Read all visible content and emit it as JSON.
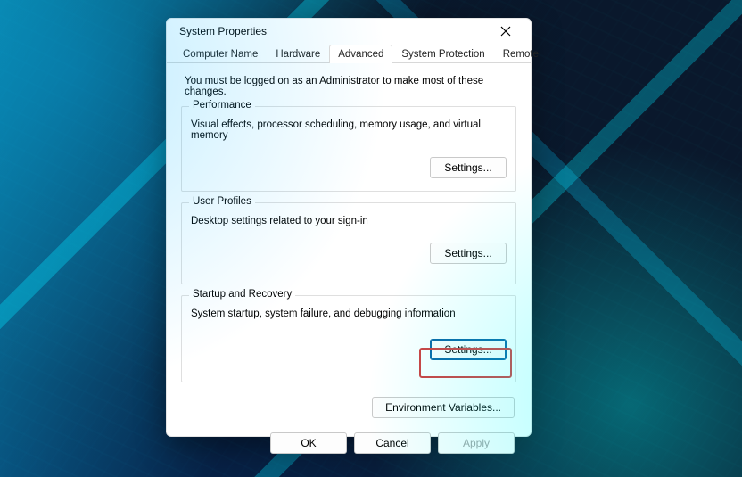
{
  "window": {
    "title": "System Properties"
  },
  "tabs": {
    "computer_name": "Computer Name",
    "hardware": "Hardware",
    "advanced": "Advanced",
    "system_protection": "System Protection",
    "remote": "Remote",
    "active": "advanced"
  },
  "advanced": {
    "admin_note": "You must be logged on as an Administrator to make most of these changes.",
    "performance": {
      "legend": "Performance",
      "desc": "Visual effects, processor scheduling, memory usage, and virtual memory",
      "button": "Settings..."
    },
    "user_profiles": {
      "legend": "User Profiles",
      "desc": "Desktop settings related to your sign-in",
      "button": "Settings..."
    },
    "startup_recovery": {
      "legend": "Startup and Recovery",
      "desc": "System startup, system failure, and debugging information",
      "button": "Settings..."
    },
    "env_button": "Environment Variables..."
  },
  "footer": {
    "ok": "OK",
    "cancel": "Cancel",
    "apply": "Apply"
  }
}
